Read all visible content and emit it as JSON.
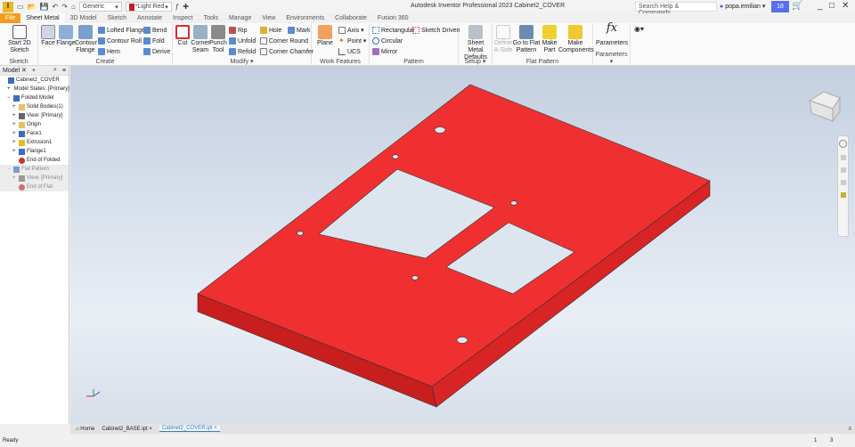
{
  "app": {
    "logo": "I",
    "title": "Autodesk Inventor Professional 2023   Cabinet2_COVER",
    "appearance_select": "Generic",
    "color_select": "*Light Red",
    "search_placeholder": "Search Help & Commands...",
    "user": "popa.emilian",
    "notifications": "18"
  },
  "tabs": [
    "File",
    "Sheet Metal",
    "3D Model",
    "Sketch",
    "Annotate",
    "Inspect",
    "Tools",
    "Manage",
    "View",
    "Environments",
    "Collaborate",
    "Fusion 360"
  ],
  "ribbon": {
    "sketch": {
      "label": "Sketch",
      "start": "Start 2D Sketch"
    },
    "create": {
      "label": "Create",
      "face": "Face",
      "flange": "Flange",
      "contour_flange": "Contour Flange",
      "lofted_flange": "Lofted Flange",
      "contour_roll": "Contour Roll",
      "hem": "Hem",
      "bend": "Bend",
      "fold": "Fold",
      "derive": "Derive"
    },
    "modify": {
      "label": "Modify ▾",
      "cut": "Cut",
      "corner_seam": "Corner Seam",
      "punch_tool": "Punch Tool",
      "rip": "Rip",
      "unfold": "Unfold",
      "refold": "Refold",
      "hole": "Hole",
      "mark": "Mark",
      "corner_round": "Corner Round",
      "corner_chamfer": "Corner Chamfer"
    },
    "work_features": {
      "label": "Work Features",
      "plane": "Plane",
      "axis": "Axis ▾",
      "point": "Point ▾",
      "ucs": "UCS"
    },
    "pattern": {
      "label": "Pattern",
      "rectangular": "Rectangular",
      "circular": "Circular",
      "mirror": "Mirror",
      "sketch_driven": "Sketch Driven"
    },
    "setup": {
      "label": "Setup ▾",
      "defaults": "Sheet Metal Defaults"
    },
    "flat_pattern": {
      "label": "Flat Pattern",
      "define_a_side": "Define A-Side",
      "go_to": "Go to Flat Pattern",
      "make_part": "Make Part",
      "make_components": "Make Components"
    },
    "parameters": {
      "label": "Parameters ▾",
      "parameters": "Parameters",
      "glyph": "fx"
    }
  },
  "browser": {
    "tab": "Model",
    "nodes": [
      {
        "label": "Cabinet2_COVER",
        "level": 0,
        "color": "#3a6fc0"
      },
      {
        "label": "Model States: [Primary]",
        "level": 1,
        "color": "#e8c060"
      },
      {
        "label": "Folded Model",
        "level": 1,
        "color": "#3a6fc0"
      },
      {
        "label": "Solid Bodies(1)",
        "level": 2,
        "color": "#e8c060"
      },
      {
        "label": "View: [Primary]",
        "level": 2,
        "color": "#666"
      },
      {
        "label": "Origin",
        "level": 2,
        "color": "#e8c060"
      },
      {
        "label": "Face1",
        "level": 2,
        "color": "#3a6fc0"
      },
      {
        "label": "Extrusion1",
        "level": 2,
        "color": "#e0c020"
      },
      {
        "label": "Flange1",
        "level": 2,
        "color": "#3a6fc0"
      },
      {
        "label": "End of Folded",
        "level": 2,
        "color": "#d03030"
      },
      {
        "label": "Flat Pattern",
        "level": 1,
        "color": "#7a9ad0"
      },
      {
        "label": "View: [Primary]",
        "level": 2,
        "color": "#999"
      },
      {
        "label": "End of Flat",
        "level": 2,
        "color": "#d07070"
      }
    ]
  },
  "model": {
    "color": "#f03030"
  },
  "doc_tabs": {
    "home": "Home",
    "tab1": "Cabinet2_BASE.ipt ×",
    "tab2": "Cabinet2_COVER.ipt ×"
  },
  "status": {
    "text": "Ready",
    "n1": "1",
    "n2": "3"
  }
}
